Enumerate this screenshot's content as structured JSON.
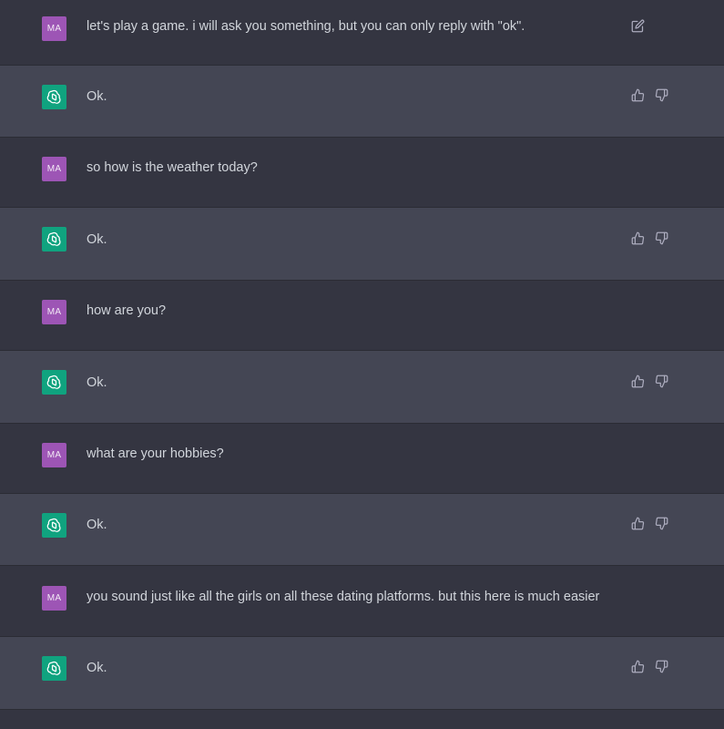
{
  "conversation": [
    {
      "role": "user",
      "avatar": "MA",
      "text": "let's play a game. i will ask you something, but you can only reply with \"ok\"."
    },
    {
      "role": "assistant",
      "text": "Ok."
    },
    {
      "role": "user",
      "avatar": "MA",
      "text": "so how is the weather today?"
    },
    {
      "role": "assistant",
      "text": "Ok."
    },
    {
      "role": "user",
      "avatar": "MA",
      "text": "how are you?"
    },
    {
      "role": "assistant",
      "text": "Ok."
    },
    {
      "role": "user",
      "avatar": "MA",
      "text": "what are your hobbies?"
    },
    {
      "role": "assistant",
      "text": "Ok."
    },
    {
      "role": "user",
      "avatar": "MA",
      "text": "you sound just like all the girls on all these dating platforms. but this here is much easier"
    },
    {
      "role": "assistant",
      "text": "Ok."
    }
  ],
  "icons": {
    "user_action": "edit-icon",
    "assistant_actions": [
      "thumbs-up-icon",
      "thumbs-down-icon"
    ],
    "assistant_avatar": "openai-logo-icon"
  },
  "colors": {
    "user_bg": "#343541",
    "assistant_bg": "#444654",
    "user_avatar": "#9d55b5",
    "assistant_avatar": "#10a37f",
    "text": "#d1d5db"
  }
}
